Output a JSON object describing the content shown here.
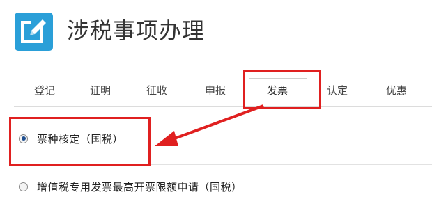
{
  "header": {
    "title": "涉税事项办理",
    "icon": "edit-icon",
    "icon_color": "#2a9fd8"
  },
  "tabs": [
    {
      "label": "登记",
      "active": false
    },
    {
      "label": "证明",
      "active": false
    },
    {
      "label": "征收",
      "active": false
    },
    {
      "label": "申报",
      "active": false
    },
    {
      "label": "发票",
      "active": true
    },
    {
      "label": "认定",
      "active": false
    },
    {
      "label": "优惠",
      "active": false
    }
  ],
  "options": [
    {
      "label": "票种核定（国税）",
      "selected": true
    },
    {
      "label": "增值税专用发票最高开票限额申请（国税）",
      "selected": false
    }
  ],
  "annotation": {
    "color": "#e02020"
  }
}
